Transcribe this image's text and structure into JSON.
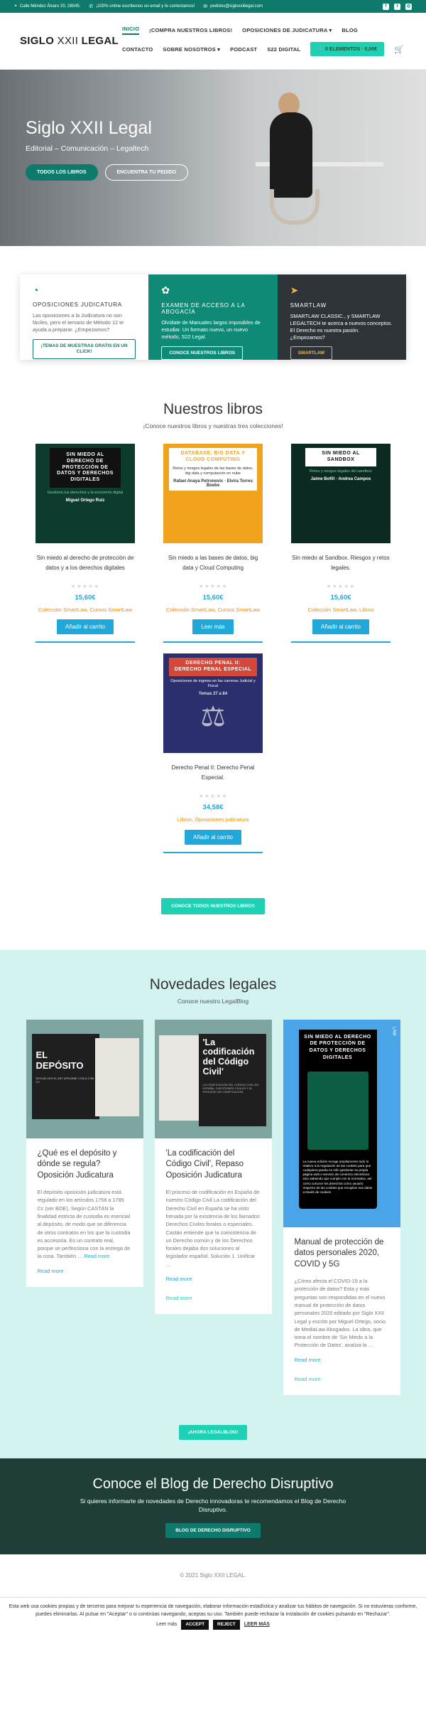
{
  "topbar": {
    "address": "Calle Méndez Álvaro 20, 28045.",
    "online": "¡100% online escríbenos un email y te contestamos!",
    "email": "pedidos@sigloxxiilegal.com",
    "social": [
      "facebook-icon",
      "twitter-icon",
      "instagram-icon"
    ]
  },
  "header": {
    "logo_a": "SIGLO ",
    "logo_b": "XXII",
    "logo_c": " LEGAL",
    "nav": [
      "INICIO",
      "¡COMPRA NUESTROS LIBROS!",
      "OPOSICIONES DE JUDICATURA ▾",
      "BLOG",
      "CONTACTO",
      "SOBRE NOSOTROS ▾",
      "PODCAST",
      "S22 DIGITAL"
    ],
    "cart": "0 ELEMENTOS · 0,00€"
  },
  "hero": {
    "title": "Siglo XXII Legal",
    "subtitle": "Editorial – Comunicación – Legaltech",
    "btn1": "TODOS LOS LIBROS",
    "btn2": "ENCUENTRA TU PEDIDO"
  },
  "cards": [
    {
      "title": "OPOSICIONES JUDICATURA",
      "text": "Las oposiciones a la Judicatura no son fáciles, pero el temario de Método 12 te ayuda a preparar. ¿Empezamos?",
      "btn": "¡TEMAS DE MUESTRAS GRATIS EN UN CLICK!"
    },
    {
      "title": "EXAMEN DE ACCESO A LA ABOGACÍA",
      "text": "Olvídate de Manuales largos imposibles de estudiar. Un formato nuevo, un nuevo método, S22 Legal.",
      "btn": "CONOCE NUESTROS LIBROS"
    },
    {
      "title": "SMARTLAW",
      "text": "SMARTLAW CLASSIC., y SMARTLAW LEGALTECH te acerca a nuevos conceptos. El Derecho es nuestra pasión. ¿Empezamos?",
      "btn": "SMARTLAW"
    }
  ],
  "books": {
    "title": "Nuestros libros",
    "subtitle": "¡Conoce nuestros libros y nuestras tres colecciones!",
    "items": [
      {
        "cover_title": "SIN MIEDO AL DERECHO DE PROTECCIÓN DE DATOS Y DERECHOS DIGITALES",
        "cover_sub": "Gestiona tus derechos y la economía digital",
        "cover_author": "Miguel Ortego Ruiz",
        "name": "Sin miedo al derecho de protección de datos y a los derechos digitales",
        "stars": "★★★★★",
        "price": "15,60€",
        "cats": "Colección SmartLaw, Cursos SmartLaw",
        "btn": "Añadir al carrito"
      },
      {
        "cover_title": "DATABASE, BIG DATA Y CLOUD COMPUTING",
        "cover_sub": "Retos y riesgos legales de las bases de datos, big data y computación en nube",
        "cover_author": "Rafael Anaya Petronovic · Elvira Torres Boebe",
        "name": "Sin miedo a las bases de datos, big data y Cloud Computing",
        "stars": "★★★★★",
        "price": "15,60€",
        "cats": "Colección SmartLaw, Cursos SmartLaw",
        "btn": "Leer más"
      },
      {
        "cover_title": "SIN MIEDO AL SANDBOX",
        "cover_sub": "Retos y riesgos legales del sandbox",
        "cover_author": "Jaime Bofill · Andrea Campos",
        "name": "Sin miedo al Sandbox. Riesgos y retos legales.",
        "stars": "★★★★★",
        "price": "15,60€",
        "cats": "Colección SmartLaw, Libros",
        "btn": "Añadir al carrito"
      },
      {
        "cover_title": "DERECHO PENAL II: DERECHO PENAL ESPECIAL",
        "cover_sub": "Oposiciones de ingreso en las carreras Judicial y Fiscal",
        "cover_author": "Temas 27 a 84",
        "name": "Derecho Penal II: Derecho Penal Especial.",
        "stars": "★★★★★",
        "price": "34,58€",
        "cats": "Libros, Oposiciones judicatura",
        "btn": "Añadir al carrito"
      }
    ],
    "all_btn": "CONOCE TODOS NUESTROS LIBROS"
  },
  "news": {
    "title": "Novedades legales",
    "subtitle": "Conoce nuestro LegalBlog",
    "posts": [
      {
        "img_text": "EL DEPÓSITO",
        "img_small": "RESUELVES EL ART APRUEBE 1758 A 1789 CC",
        "title": "¿Qué es el depósito y dónde se regula? Oposición Judicatura",
        "excerpt": "El depósito oposición judicatura está regulado en los artículos 1758 a 1789 Cc (ver BOE). Según CASTÁN la finalidad estricta de custodia es esencial al depósito, de modo que se diferencia de otros contratos en los que la custodia es accesoria. Es un contrato real, porque se perfecciona con la entrega de la cosa. También …",
        "excerpt_link": "Read more",
        "more": "Read more"
      },
      {
        "img_text": "'La codificación del Código Civil'",
        "img_small": "LA CODIFICACIÓN DEL CÓDIGO CIVIL EN ESPAÑA, CUESTIONES CIVILES Y EL PROCESO DE CODIFICACIÓN",
        "title": "'La codificación del Código Civil', Repaso Oposición Judicatura",
        "excerpt": "El proceso de codificación en España de nuestro Código Civil La codificación del Derecho Civil en España se ha visto frenada por la existencia de los llamados Derechos Civiles forales o especiales. Castán entiende que la coexistencia de un Derecho común y de los Derechos forales dejaba dos soluciones al legislador español. Solución 1. Unificar …",
        "more1": "Read more",
        "more": "Read more"
      },
      {
        "img_text": "SIN MIEDO AL DERECHO DE PROTECCIÓN DE DATOS Y DERECHOS DIGITALES",
        "img_small": "La nueva edición recoge ampliamente todo lo relativo a la regulación de las cookies para que cualquiera pueda no sólo gestionar su propia página web o servicio de comercio electrónico sino sabiendo que cumple con la normativa, así como conocer los derechos como usuario respecto de las cookies que recopilan sus datos a través de cookies",
        "law": "LAW",
        "title": "Manual de protección de datos personales 2020, COVID y 5G",
        "excerpt": "¿Cómo afecta el COVID-19 a la protección de datos? Esta y más preguntas son respondidas en el nuevo manual de protección de datos personales 2020 editado por Siglo XXII Legal y escrito por Miguel Ortego, socio de MediaLaw Abogados. La obra, que toma el nombre de 'Sin Miedo a la Protección de Datos', analiza la …",
        "more1": "Read more",
        "more": "Read more"
      }
    ],
    "btn": "¡AHORA LEGALBLOG!"
  },
  "blog": {
    "title": "Conoce el Blog de Derecho Disruptivo",
    "text": "Si quieres informarte de novedades de Derecho innovadoras te recomendamos el Blog de Derecho Disruptivo.",
    "btn": "BLOG DE DERECHO DISRUPTIVO"
  },
  "footer": {
    "copy": "© 2021 Siglo XXII LEGAL."
  },
  "cookie": {
    "text": "Esta web usa cookies propias y de terceros para mejorar tu experiencia de navegación, elaborar información estadística y analizar tus hábitos de navegación. Si no estuvieras conforme, puedes eliminarlas. Al pulsar en \"Aceptar\" o si continúas navegando, aceptas su uso. También puede rechazar la instalación de cookies pulsando en \"Rechazar\".",
    "read_more": "Leer más",
    "accept": "ACCEPT",
    "reject": "REJECT",
    "more": "LEER MÁS"
  }
}
